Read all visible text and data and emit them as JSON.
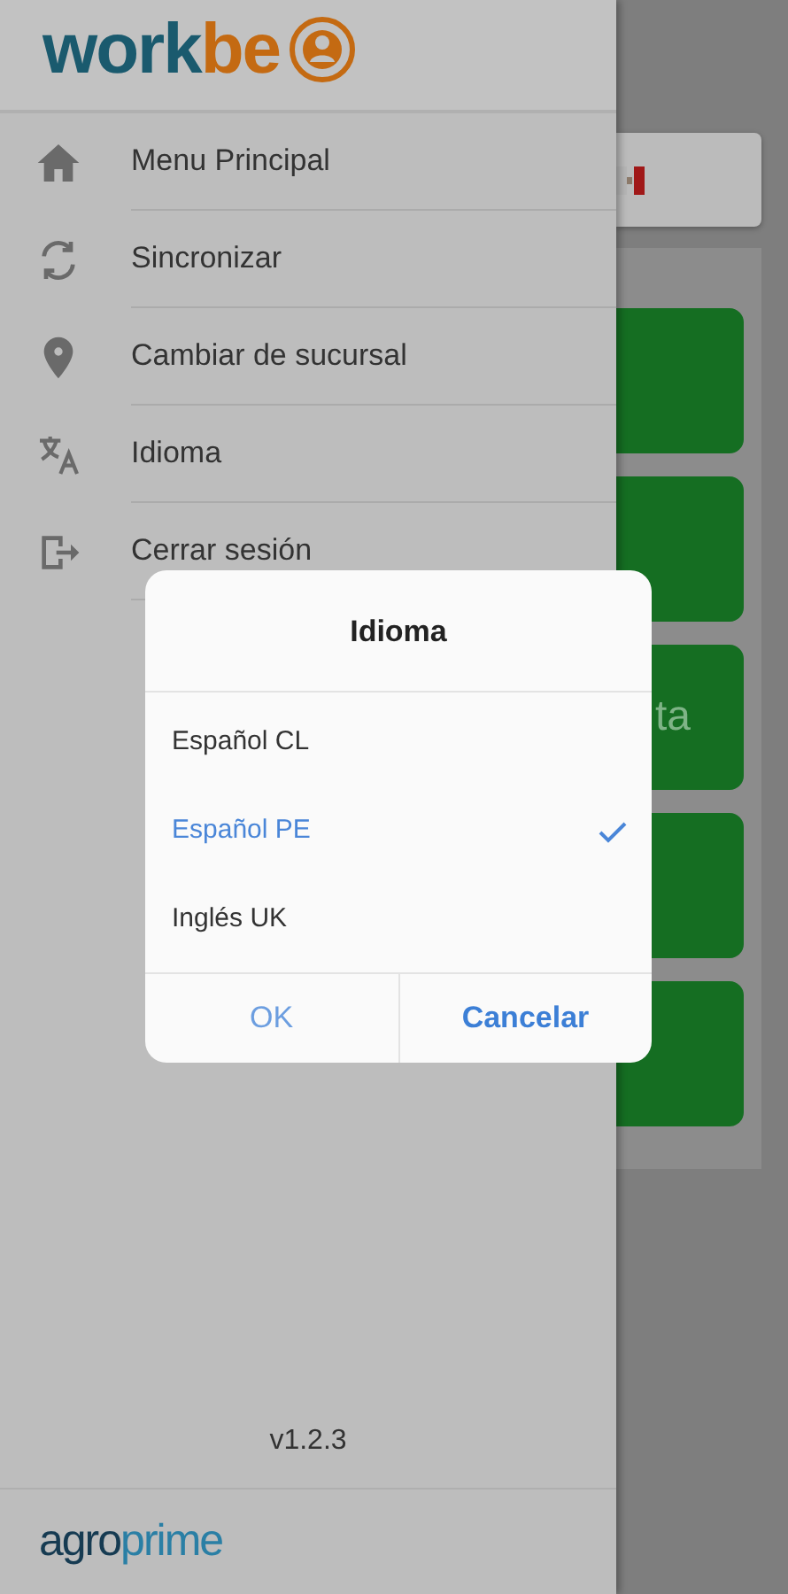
{
  "drawer": {
    "logo": {
      "part_1": "work",
      "part_2": "be"
    },
    "items": [
      {
        "kind": "home",
        "label": "Menu Principal"
      },
      {
        "kind": "sync",
        "label": "Sincronizar"
      },
      {
        "kind": "branch",
        "label": "Cambiar de sucursal"
      },
      {
        "kind": "language",
        "label": "Idioma"
      },
      {
        "kind": "logout",
        "label": "Cerrar sesión"
      }
    ],
    "version": "v1.2.3",
    "footer_logo": {
      "part_1": "agro",
      "part_2": "prime"
    }
  },
  "background_tiles": [
    {
      "kind": "tile"
    },
    {
      "kind": "tile"
    },
    {
      "kind": "tile",
      "text": "ta"
    },
    {
      "kind": "tile"
    },
    {
      "kind": "tile"
    }
  ],
  "dialog": {
    "title": "Idioma",
    "options": [
      {
        "label": "Español CL",
        "selected": false
      },
      {
        "label": "Español PE",
        "selected": true
      },
      {
        "label": "Inglés UK",
        "selected": false
      }
    ],
    "buttons": [
      {
        "label": "OK",
        "kind": "secondary"
      },
      {
        "label": "Cancelar",
        "kind": "primary"
      }
    ]
  }
}
